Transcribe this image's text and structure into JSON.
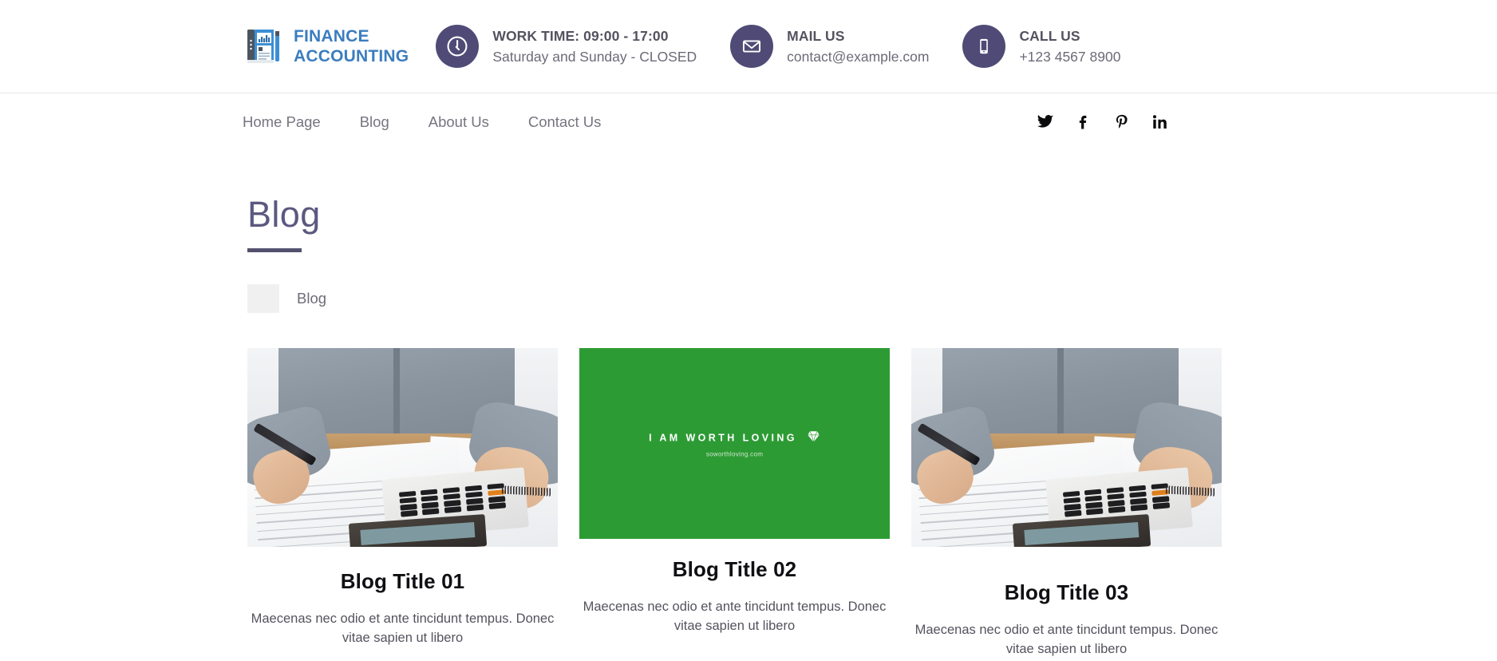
{
  "header": {
    "logo": {
      "icon": "finance-report-icon",
      "line1": "FINANCE",
      "line2": "ACCOUNTING",
      "color": "#3b7dbf"
    },
    "info_items": [
      {
        "icon": "clock-icon",
        "title": "WORK TIME: 09:00 - 17:00",
        "subtitle": "Saturday and Sunday - CLOSED"
      },
      {
        "icon": "envelope-icon",
        "title": "MAIL US",
        "subtitle": "contact@example.com"
      },
      {
        "icon": "mobile-phone-icon",
        "title": "CALL US",
        "subtitle": "+123 4567 8900"
      }
    ],
    "accent_circle_color": "#4f4b76"
  },
  "nav": {
    "links": [
      {
        "label": "Home Page"
      },
      {
        "label": "Blog"
      },
      {
        "label": "About Us"
      },
      {
        "label": "Contact Us"
      }
    ],
    "social": [
      {
        "icon": "twitter-icon",
        "label": "Twitter"
      },
      {
        "icon": "facebook-icon",
        "label": "Facebook"
      },
      {
        "icon": "pinterest-icon",
        "label": "Pinterest"
      },
      {
        "icon": "linkedin-icon",
        "label": "LinkedIn"
      }
    ]
  },
  "page": {
    "title": "Blog",
    "title_color": "#5b5880",
    "rule_color": "#54516f"
  },
  "breadcrumb": {
    "label": "Blog"
  },
  "cards": [
    {
      "media_type": "photo",
      "media_name": "accountant-with-calculator-photo",
      "title": "Blog Title 01",
      "text": "Maecenas nec odio et ante tincidunt tempus. Donec vitae sapien ut libero"
    },
    {
      "media_type": "green-banner",
      "media_name": "i-am-worth-loving-banner",
      "banner": {
        "text": "I AM WORTH LOVING",
        "icon": "diamond-heart-icon",
        "url": "soworthloving.com",
        "background": "#2d9b34"
      },
      "title": "Blog Title 02",
      "text": "Maecenas nec odio et ante tincidunt tempus. Donec vitae sapien ut libero"
    },
    {
      "media_type": "photo",
      "media_name": "accountant-with-calculator-photo",
      "title": "Blog Title 03",
      "text": "Maecenas nec odio et ante tincidunt tempus. Donec vitae sapien ut libero"
    }
  ]
}
